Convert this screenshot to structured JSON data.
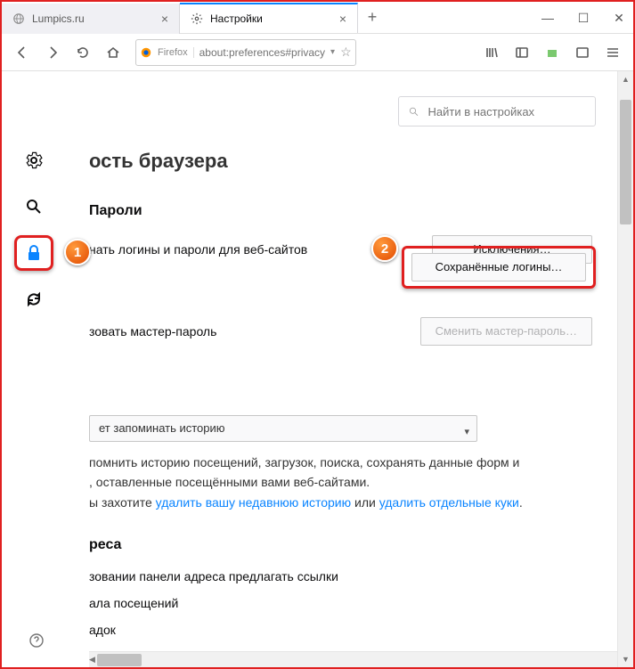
{
  "window": {
    "tabs": [
      {
        "title": "Lumpics.ru",
        "active": false
      },
      {
        "title": "Настройки",
        "active": true
      }
    ],
    "url_brand": "Firefox",
    "url": "about:preferences#privacy"
  },
  "search": {
    "placeholder": "Найти в настройках"
  },
  "sidebar": {
    "items": [
      {
        "name": "general",
        "icon": "gear"
      },
      {
        "name": "search",
        "icon": "search"
      },
      {
        "name": "privacy",
        "icon": "lock",
        "selected": true
      },
      {
        "name": "sync",
        "icon": "sync"
      }
    ]
  },
  "annotations": {
    "badge1": "1",
    "badge2": "2"
  },
  "heading_clip": "ость браузера",
  "passwords": {
    "title": "Пароли",
    "remember_clip": "нать логины и пароли для веб-сайтов",
    "exceptions_btn": "Исключения…",
    "saved_btn": "Сохранённые логины…",
    "master_clip": "зовать мастер-пароль",
    "change_master_btn": "Сменить мастер-пароль…"
  },
  "history": {
    "select_clip": "ет запоминать историю",
    "para_line1_clip": "помнить историю посещений, загрузок, поиска, сохранять данные форм и",
    "para_line2_clip": ", оставленные посещёнными вами веб-сайтами.",
    "para_line3_pre": "ы захотите ",
    "link1": "удалить вашу недавнюю историю",
    "para_line3_mid": " или ",
    "link2": "удалить отдельные куки",
    "para_line3_end": "."
  },
  "address": {
    "title_clip": "реса",
    "line1_clip": "зовании панели адреса предлагать ссылки",
    "line2_clip": "ала посещений",
    "line3_clip": "адок"
  }
}
